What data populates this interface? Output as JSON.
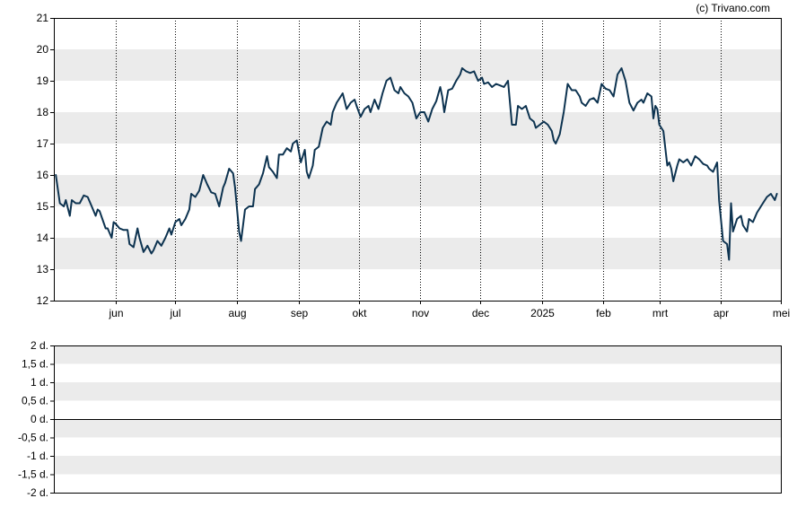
{
  "credit": "(c) Trivano.com",
  "colors": {
    "line": "#0d3350",
    "band": "#ebebeb",
    "axis": "#000000",
    "grid": "#000000"
  },
  "chart_data": [
    {
      "type": "line",
      "title": "",
      "xlabel": "",
      "ylabel": "",
      "grid": "vertical dotted lines at month starts; alternating horizontal bands",
      "legend": "none",
      "ylim": [
        12,
        21
      ],
      "yticks": [
        "12",
        "13",
        "14",
        "15",
        "16",
        "17",
        "18",
        "19",
        "20",
        "21"
      ],
      "xticks": [
        {
          "label": "jun",
          "date": "2024-06-01"
        },
        {
          "label": "jul",
          "date": "2024-07-01"
        },
        {
          "label": "aug",
          "date": "2024-08-01"
        },
        {
          "label": "sep",
          "date": "2024-09-01"
        },
        {
          "label": "okt",
          "date": "2024-10-01"
        },
        {
          "label": "nov",
          "date": "2024-11-01"
        },
        {
          "label": "dec",
          "date": "2024-12-01"
        },
        {
          "label": "2025",
          "date": "2025-01-01"
        },
        {
          "label": "feb",
          "date": "2025-02-01"
        },
        {
          "label": "mrt",
          "date": "2025-03-01"
        },
        {
          "label": "apr",
          "date": "2025-04-01"
        },
        {
          "label": "mei",
          "date": "2025-05-01"
        }
      ],
      "series": [
        {
          "points": [
            [
              "2024-05-02",
              16.0
            ],
            [
              "2024-05-04",
              15.1
            ],
            [
              "2024-05-06",
              15.0
            ],
            [
              "2024-05-07",
              15.2
            ],
            [
              "2024-05-09",
              14.7
            ],
            [
              "2024-05-10",
              15.2
            ],
            [
              "2024-05-12",
              15.1
            ],
            [
              "2024-05-14",
              15.1
            ],
            [
              "2024-05-16",
              15.35
            ],
            [
              "2024-05-18",
              15.3
            ],
            [
              "2024-05-20",
              15.0
            ],
            [
              "2024-05-22",
              14.7
            ],
            [
              "2024-05-23",
              14.9
            ],
            [
              "2024-05-24",
              14.85
            ],
            [
              "2024-05-27",
              14.3
            ],
            [
              "2024-05-28",
              14.3
            ],
            [
              "2024-05-30",
              14.0
            ],
            [
              "2024-05-31",
              14.5
            ],
            [
              "2024-06-01",
              14.45
            ],
            [
              "2024-06-03",
              14.3
            ],
            [
              "2024-06-05",
              14.25
            ],
            [
              "2024-06-07",
              14.25
            ],
            [
              "2024-06-08",
              13.8
            ],
            [
              "2024-06-10",
              13.7
            ],
            [
              "2024-06-12",
              14.3
            ],
            [
              "2024-06-13",
              14.0
            ],
            [
              "2024-06-15",
              13.55
            ],
            [
              "2024-06-17",
              13.75
            ],
            [
              "2024-06-19",
              13.5
            ],
            [
              "2024-06-20",
              13.6
            ],
            [
              "2024-06-22",
              13.9
            ],
            [
              "2024-06-24",
              13.75
            ],
            [
              "2024-06-26",
              14.0
            ],
            [
              "2024-06-28",
              14.3
            ],
            [
              "2024-06-29",
              14.1
            ],
            [
              "2024-07-01",
              14.5
            ],
            [
              "2024-07-03",
              14.6
            ],
            [
              "2024-07-04",
              14.4
            ],
            [
              "2024-07-06",
              14.6
            ],
            [
              "2024-07-08",
              14.9
            ],
            [
              "2024-07-09",
              15.4
            ],
            [
              "2024-07-11",
              15.3
            ],
            [
              "2024-07-13",
              15.5
            ],
            [
              "2024-07-15",
              16.0
            ],
            [
              "2024-07-17",
              15.7
            ],
            [
              "2024-07-19",
              15.45
            ],
            [
              "2024-07-21",
              15.4
            ],
            [
              "2024-07-23",
              15.0
            ],
            [
              "2024-07-25",
              15.6
            ],
            [
              "2024-07-26",
              15.75
            ],
            [
              "2024-07-28",
              16.2
            ],
            [
              "2024-07-30",
              16.05
            ],
            [
              "2024-07-31",
              15.6
            ],
            [
              "2024-08-02",
              14.2
            ],
            [
              "2024-08-03",
              13.9
            ],
            [
              "2024-08-05",
              14.9
            ],
            [
              "2024-08-07",
              15.0
            ],
            [
              "2024-08-09",
              15.0
            ],
            [
              "2024-08-10",
              15.55
            ],
            [
              "2024-08-12",
              15.7
            ],
            [
              "2024-08-14",
              16.05
            ],
            [
              "2024-08-16",
              16.6
            ],
            [
              "2024-08-17",
              16.25
            ],
            [
              "2024-08-19",
              16.1
            ],
            [
              "2024-08-21",
              15.9
            ],
            [
              "2024-08-22",
              16.65
            ],
            [
              "2024-08-24",
              16.65
            ],
            [
              "2024-08-26",
              16.85
            ],
            [
              "2024-08-28",
              16.75
            ],
            [
              "2024-08-29",
              17.0
            ],
            [
              "2024-08-31",
              17.1
            ],
            [
              "2024-09-02",
              16.4
            ],
            [
              "2024-09-04",
              16.8
            ],
            [
              "2024-09-05",
              16.1
            ],
            [
              "2024-09-06",
              15.9
            ],
            [
              "2024-09-08",
              16.3
            ],
            [
              "2024-09-09",
              16.8
            ],
            [
              "2024-09-11",
              16.9
            ],
            [
              "2024-09-13",
              17.5
            ],
            [
              "2024-09-15",
              17.7
            ],
            [
              "2024-09-17",
              17.6
            ],
            [
              "2024-09-18",
              18.0
            ],
            [
              "2024-09-20",
              18.3
            ],
            [
              "2024-09-22",
              18.5
            ],
            [
              "2024-09-23",
              18.6
            ],
            [
              "2024-09-25",
              18.1
            ],
            [
              "2024-09-27",
              18.3
            ],
            [
              "2024-09-29",
              18.4
            ],
            [
              "2024-09-30",
              18.2
            ],
            [
              "2024-10-02",
              17.85
            ],
            [
              "2024-10-04",
              18.1
            ],
            [
              "2024-10-06",
              18.2
            ],
            [
              "2024-10-07",
              18.0
            ],
            [
              "2024-10-09",
              18.4
            ],
            [
              "2024-10-11",
              18.1
            ],
            [
              "2024-10-13",
              18.6
            ],
            [
              "2024-10-15",
              19.0
            ],
            [
              "2024-10-17",
              19.1
            ],
            [
              "2024-10-19",
              18.7
            ],
            [
              "2024-10-21",
              18.6
            ],
            [
              "2024-10-22",
              18.8
            ],
            [
              "2024-10-24",
              18.6
            ],
            [
              "2024-10-26",
              18.5
            ],
            [
              "2024-10-28",
              18.3
            ],
            [
              "2024-10-30",
              17.8
            ],
            [
              "2024-11-01",
              18.0
            ],
            [
              "2024-11-03",
              18.0
            ],
            [
              "2024-11-05",
              17.7
            ],
            [
              "2024-11-07",
              18.1
            ],
            [
              "2024-11-09",
              18.35
            ],
            [
              "2024-11-11",
              18.8
            ],
            [
              "2024-11-12",
              18.5
            ],
            [
              "2024-11-13",
              18.0
            ],
            [
              "2024-11-15",
              18.7
            ],
            [
              "2024-11-17",
              18.75
            ],
            [
              "2024-11-19",
              19.0
            ],
            [
              "2024-11-21",
              19.2
            ],
            [
              "2024-11-22",
              19.4
            ],
            [
              "2024-11-24",
              19.3
            ],
            [
              "2024-11-26",
              19.25
            ],
            [
              "2024-11-28",
              19.3
            ],
            [
              "2024-11-30",
              19.0
            ],
            [
              "2024-12-02",
              19.1
            ],
            [
              "2024-12-03",
              18.9
            ],
            [
              "2024-12-05",
              18.95
            ],
            [
              "2024-12-07",
              18.8
            ],
            [
              "2024-12-09",
              18.9
            ],
            [
              "2024-12-11",
              18.85
            ],
            [
              "2024-12-13",
              18.8
            ],
            [
              "2024-12-15",
              19.0
            ],
            [
              "2024-12-17",
              17.6
            ],
            [
              "2024-12-19",
              17.6
            ],
            [
              "2024-12-20",
              18.2
            ],
            [
              "2024-12-22",
              18.1
            ],
            [
              "2024-12-24",
              18.2
            ],
            [
              "2024-12-26",
              17.8
            ],
            [
              "2024-12-28",
              17.7
            ],
            [
              "2024-12-29",
              17.5
            ],
            [
              "2024-12-31",
              17.6
            ],
            [
              "2025-01-02",
              17.7
            ],
            [
              "2025-01-04",
              17.6
            ],
            [
              "2025-01-06",
              17.4
            ],
            [
              "2025-01-07",
              17.1
            ],
            [
              "2025-01-08",
              17.0
            ],
            [
              "2025-01-10",
              17.3
            ],
            [
              "2025-01-12",
              18.0
            ],
            [
              "2025-01-14",
              18.9
            ],
            [
              "2025-01-16",
              18.7
            ],
            [
              "2025-01-18",
              18.7
            ],
            [
              "2025-01-20",
              18.5
            ],
            [
              "2025-01-21",
              18.3
            ],
            [
              "2025-01-23",
              18.2
            ],
            [
              "2025-01-25",
              18.4
            ],
            [
              "2025-01-27",
              18.45
            ],
            [
              "2025-01-29",
              18.3
            ],
            [
              "2025-01-31",
              18.9
            ],
            [
              "2025-02-02",
              18.75
            ],
            [
              "2025-02-04",
              18.7
            ],
            [
              "2025-02-06",
              18.5
            ],
            [
              "2025-02-08",
              19.2
            ],
            [
              "2025-02-10",
              19.4
            ],
            [
              "2025-02-12",
              19.0
            ],
            [
              "2025-02-14",
              18.3
            ],
            [
              "2025-02-16",
              18.05
            ],
            [
              "2025-02-18",
              18.3
            ],
            [
              "2025-02-20",
              18.4
            ],
            [
              "2025-02-21",
              18.3
            ],
            [
              "2025-02-23",
              18.6
            ],
            [
              "2025-02-25",
              18.5
            ],
            [
              "2025-02-26",
              17.8
            ],
            [
              "2025-02-27",
              18.2
            ],
            [
              "2025-02-28",
              18.1
            ],
            [
              "2025-03-01",
              17.6
            ],
            [
              "2025-03-03",
              17.4
            ],
            [
              "2025-03-05",
              16.3
            ],
            [
              "2025-03-06",
              16.4
            ],
            [
              "2025-03-07",
              16.2
            ],
            [
              "2025-03-08",
              15.8
            ],
            [
              "2025-03-10",
              16.3
            ],
            [
              "2025-03-11",
              16.5
            ],
            [
              "2025-03-13",
              16.4
            ],
            [
              "2025-03-15",
              16.5
            ],
            [
              "2025-03-17",
              16.3
            ],
            [
              "2025-03-19",
              16.6
            ],
            [
              "2025-03-21",
              16.5
            ],
            [
              "2025-03-23",
              16.35
            ],
            [
              "2025-03-25",
              16.3
            ],
            [
              "2025-03-26",
              16.2
            ],
            [
              "2025-03-28",
              16.1
            ],
            [
              "2025-03-30",
              16.4
            ],
            [
              "2025-03-31",
              15.2
            ],
            [
              "2025-04-02",
              13.9
            ],
            [
              "2025-04-04",
              13.8
            ],
            [
              "2025-04-05",
              13.3
            ],
            [
              "2025-04-06",
              15.1
            ],
            [
              "2025-04-07",
              14.2
            ],
            [
              "2025-04-09",
              14.6
            ],
            [
              "2025-04-11",
              14.7
            ],
            [
              "2025-04-12",
              14.4
            ],
            [
              "2025-04-14",
              14.2
            ],
            [
              "2025-04-15",
              14.6
            ],
            [
              "2025-04-17",
              14.5
            ],
            [
              "2025-04-19",
              14.8
            ],
            [
              "2025-04-20",
              14.9
            ],
            [
              "2025-04-22",
              15.1
            ],
            [
              "2025-04-24",
              15.3
            ],
            [
              "2025-04-26",
              15.4
            ],
            [
              "2025-04-28",
              15.2
            ],
            [
              "2025-04-29",
              15.4
            ]
          ]
        }
      ]
    },
    {
      "type": "line",
      "title": "",
      "xlabel": "",
      "ylabel": "",
      "grid": "alternating horizontal bands",
      "legend": "none",
      "ylim": [
        -2,
        2
      ],
      "yticks": [
        "2 d.",
        "1,5 d.",
        "1 d.",
        "0,5 d.",
        "0 d.",
        "-0,5 d.",
        "-1 d.",
        "-1,5 d.",
        "-2 d."
      ],
      "series": []
    }
  ]
}
